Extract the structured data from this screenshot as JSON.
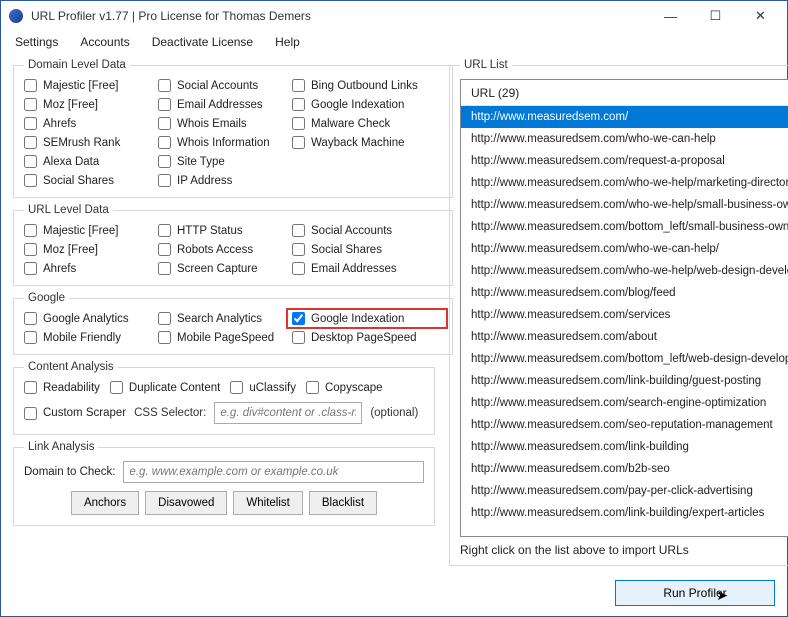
{
  "window": {
    "title": "URL Profiler v1.77 | Pro License for Thomas Demers"
  },
  "menu": {
    "settings": "Settings",
    "accounts": "Accounts",
    "deactivate": "Deactivate License",
    "help": "Help"
  },
  "groups": {
    "domain": "Domain Level Data",
    "url": "URL Level Data",
    "google": "Google",
    "content": "Content Analysis",
    "link": "Link Analysis",
    "urllist": "URL List"
  },
  "domain": {
    "majestic": "Majestic [Free]",
    "social_accounts": "Social Accounts",
    "bing_outbound": "Bing Outbound Links",
    "moz": "Moz [Free]",
    "email_addresses": "Email Addresses",
    "google_indexation": "Google Indexation",
    "ahrefs": "Ahrefs",
    "whois_emails": "Whois Emails",
    "malware": "Malware Check",
    "semrush": "SEMrush Rank",
    "whois_info": "Whois Information",
    "wayback": "Wayback Machine",
    "alexa": "Alexa Data",
    "site_type": "Site Type",
    "social_shares": "Social Shares",
    "ip_address": "IP Address"
  },
  "url": {
    "majestic": "Majestic [Free]",
    "http_status": "HTTP Status",
    "social_accounts": "Social Accounts",
    "moz": "Moz [Free]",
    "robots": "Robots Access",
    "social_shares": "Social Shares",
    "ahrefs": "Ahrefs",
    "screen_capture": "Screen Capture",
    "email_addresses": "Email Addresses"
  },
  "google": {
    "analytics": "Google Analytics",
    "search_analytics": "Search Analytics",
    "google_indexation": "Google Indexation",
    "mobile_friendly": "Mobile Friendly",
    "mobile_pagespeed": "Mobile PageSpeed",
    "desktop_pagespeed": "Desktop PageSpeed"
  },
  "content": {
    "readability": "Readability",
    "duplicate": "Duplicate Content",
    "uclassify": "uClassify",
    "copyscape": "Copyscape",
    "custom_scraper": "Custom Scraper",
    "css_selector_label": "CSS Selector:",
    "css_selector_placeholder": "e.g. div#content or .class-na",
    "optional": "(optional)"
  },
  "link": {
    "domain_label": "Domain to Check:",
    "domain_placeholder": "e.g. www.example.com or example.co.uk",
    "anchors": "Anchors",
    "disavowed": "Disavowed",
    "whitelist": "Whitelist",
    "blacklist": "Blacklist"
  },
  "urllist": {
    "header": "URL (29)",
    "hint": "Right click on the list above to import URLs",
    "items": [
      "http://www.measuredsem.com/",
      "http://www.measuredsem.com/who-we-can-help",
      "http://www.measuredsem.com/request-a-proposal",
      "http://www.measuredsem.com/who-we-help/marketing-directors",
      "http://www.measuredsem.com/who-we-help/small-business-own",
      "http://www.measuredsem.com/bottom_left/small-business-owne",
      "http://www.measuredsem.com/who-we-can-help/",
      "http://www.measuredsem.com/who-we-help/web-design-develo",
      "http://www.measuredsem.com/blog/feed",
      "http://www.measuredsem.com/services",
      "http://www.measuredsem.com/about",
      "http://www.measuredsem.com/bottom_left/web-design-developn",
      "http://www.measuredsem.com/link-building/guest-posting",
      "http://www.measuredsem.com/search-engine-optimization",
      "http://www.measuredsem.com/seo-reputation-management",
      "http://www.measuredsem.com/link-building",
      "http://www.measuredsem.com/b2b-seo",
      "http://www.measuredsem.com/pay-per-click-advertising",
      "http://www.measuredsem.com/link-building/expert-articles"
    ]
  },
  "run": {
    "label": "Run Profiler"
  }
}
